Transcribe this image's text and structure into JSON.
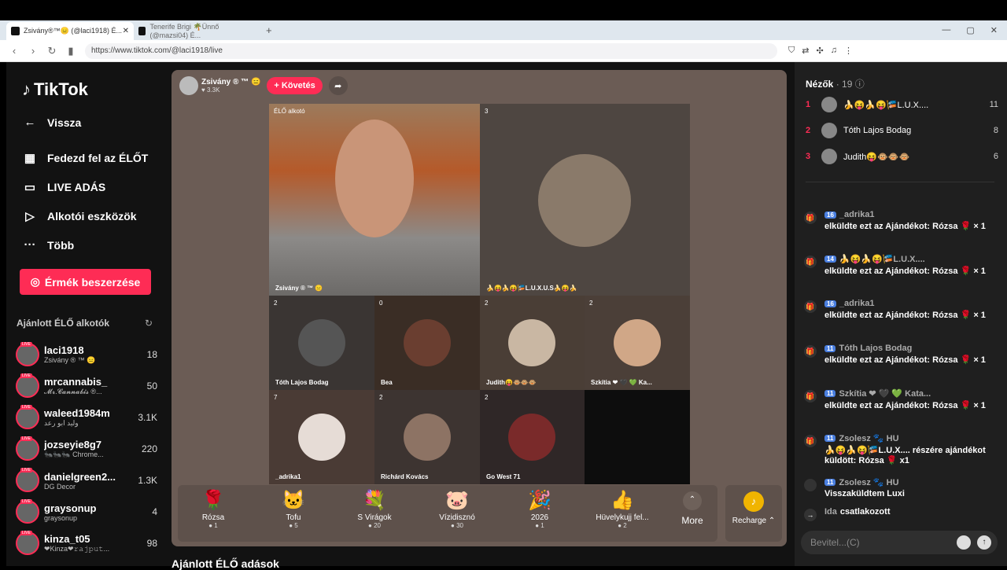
{
  "browser": {
    "tabs": [
      {
        "title": "Zsivány®™😑 (@laci1918) É..."
      },
      {
        "title": "Tenerife Brigi 🌴Ünnő (@mazsi04) É..."
      }
    ],
    "new_tab": "+",
    "url": "https://www.tiktok.com/@laci1918/live"
  },
  "sidebar": {
    "logo": "TikTok",
    "back": "Vissza",
    "nav": [
      "Fedezd fel az ÉLŐT",
      "LIVE ADÁS",
      "Alkotói eszközök",
      "Több"
    ],
    "coins_button": "Érmék beszerzése",
    "recommended_heading": "Ajánlott ÉLŐ alkotók",
    "creators": [
      {
        "name": "laci1918",
        "sub": "Zsivány ® ™ 😑",
        "count": "18"
      },
      {
        "name": "mrcannabis_",
        "sub": "𝓜𝓻.𝓒𝓪𝓷𝓷𝓪𝓫𝓲𝓼 ®...",
        "count": "50"
      },
      {
        "name": "waleed1984m",
        "sub": "وليد ابو رعد",
        "count": "3.1K"
      },
      {
        "name": "jozseyie8g7",
        "sub": "🐜🐜🐜 Chrome...",
        "count": "220"
      },
      {
        "name": "danielgreen2...",
        "sub": "DG Decor",
        "count": "1.3K"
      },
      {
        "name": "graysonup",
        "sub": "graysonup",
        "count": "4"
      },
      {
        "name": "kinza_t05",
        "sub": "❤Kinza❤𝚛𝚊𝚓𝚙𝚞𝚝...",
        "count": "98"
      }
    ]
  },
  "stage": {
    "host_name": "Zsivány ® ™ 😑",
    "host_likes": "♥ 3.3K",
    "follow_label": "+ Követés",
    "main_label": "ÉLŐ alkotó",
    "main_name": "Zsivány ® ™ 😑",
    "guest1_count": "3",
    "guest1_name": "🍌😝🍌😝🎏L.U.X.U.S🍌😝🍌",
    "guests": [
      {
        "count": "2",
        "name": "Tóth Lajos Bodag"
      },
      {
        "count": "0",
        "name": "Bea"
      },
      {
        "count": "2",
        "name": "Judith😝🐵🐵🐵"
      },
      {
        "count": "2",
        "name": "Szkítia ❤ 🖤 💚 Ka..."
      },
      {
        "count": "7",
        "name": "_adrika1"
      },
      {
        "count": "2",
        "name": "Richárd Kovács"
      },
      {
        "count": "2",
        "name": "Go West 71"
      }
    ]
  },
  "gifts": [
    {
      "icon": "🌹",
      "name": "Rózsa",
      "price": "1"
    },
    {
      "icon": "🐱",
      "name": "Tofu",
      "price": "5"
    },
    {
      "icon": "💐",
      "name": "S Virágok",
      "price": "20"
    },
    {
      "icon": "🐷",
      "name": "Vízidisznó",
      "price": "30"
    },
    {
      "icon": "🎉",
      "name": "2026",
      "price": "1"
    },
    {
      "icon": "👍",
      "name": "Hüvelykujj fel...",
      "price": "2"
    }
  ],
  "more_label": "More",
  "recharge_label": "Recharge ⌃",
  "bottom_heading": "Ajánlott ÉLŐ adások",
  "viewers": {
    "title": "Nézők",
    "count": "· 19",
    "list": [
      {
        "rank": "1",
        "name": "🍌😝🍌😝🎏L.U.X....",
        "count": "11"
      },
      {
        "rank": "2",
        "name": "Tóth Lajos Bodag",
        "count": "8"
      },
      {
        "rank": "3",
        "name": "Judith😝🐵🐵🐵",
        "count": "6"
      }
    ]
  },
  "chat": [
    {
      "badge": "16",
      "user": "_adrika1",
      "text": "elküldte ezt az Ajándékot: Rózsa 🌹 × 1"
    },
    {
      "badge": "14",
      "user": "🍌😝🍌😝🎏L.U.X....",
      "text": "elküldte ezt az Ajándékot: Rózsa 🌹 × 1"
    },
    {
      "badge": "16",
      "user": "_adrika1",
      "text": "elküldte ezt az Ajándékot: Rózsa 🌹 × 1"
    },
    {
      "badge": "11",
      "user": "Tóth Lajos Bodag",
      "text": "elküldte ezt az Ajándékot: Rózsa 🌹 × 1"
    },
    {
      "badge": "11",
      "user": "Szkítia ❤ 🖤 💚 Kata...",
      "text": "elküldte ezt az Ajándékot: Rózsa 🌹 × 1"
    },
    {
      "badge": "11",
      "user": "Zsolesz 🐾 HU",
      "text": "🍌😝🍌😝🎏L.U.X.... részére ajándékot küldött: Rózsa 🌹 x1"
    },
    {
      "badge": "11",
      "user": "Zsolesz 🐾 HU",
      "text": "Visszaküldtem Luxi"
    },
    {
      "badge": "",
      "user": "Ida",
      "text": "csatlakozott"
    }
  ],
  "input_placeholder": "Bevitel...(C)"
}
